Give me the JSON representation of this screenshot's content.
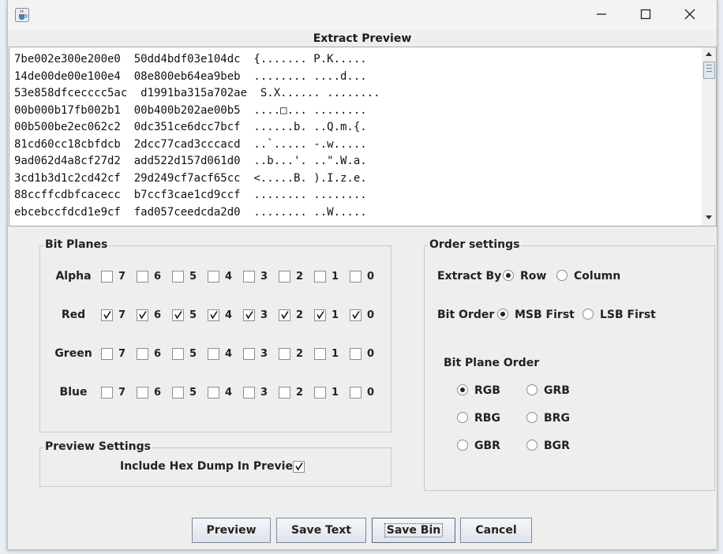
{
  "window": {
    "icon": "java-cup-icon",
    "controls": [
      "minimize-icon",
      "maximize-icon",
      "close-icon"
    ]
  },
  "preview": {
    "title": "Extract Preview",
    "lines": [
      "7be002e300e200e0  50dd4bdf03e104dc  {....... P.K.....",
      "14de00de00e100e4  08e800eb64ea9beb  ........ ....d...",
      "53e858dfcecccc5ac  d1991ba315a702ae  S.X...... ........",
      "00b000b17fb002b1  00b400b202ae00b5  ....□... ........",
      "00b500be2ec062c2  0dc351ce6dcc7bcf  ......b. ..Q.m.{.",
      "81cd60cc18cbfdcb  2dcc77cad3cccacd  ..`..... -.w.....",
      "9ad062d4a8cf27d2  add522d157d061d0  ..b...'. ..\".W.a.",
      "3cd1b3d1c2cd42cf  29d249cf7acf65cc  <.....B. ).I.z.e.",
      "88ccffcdbfcacecc  b7ccf3cae1cd9ccf  ........ ........",
      "ebcebccfdcd1e9cf  fad057ceedcda2d0  ........ ..W....."
    ]
  },
  "bit_planes": {
    "title": "Bit Planes",
    "bits": [
      "7",
      "6",
      "5",
      "4",
      "3",
      "2",
      "1",
      "0"
    ],
    "channels": [
      {
        "name": "Alpha",
        "checked": [
          false,
          false,
          false,
          false,
          false,
          false,
          false,
          false
        ]
      },
      {
        "name": "Red",
        "checked": [
          true,
          true,
          true,
          true,
          true,
          true,
          true,
          true
        ]
      },
      {
        "name": "Green",
        "checked": [
          false,
          false,
          false,
          false,
          false,
          false,
          false,
          false
        ]
      },
      {
        "name": "Blue",
        "checked": [
          false,
          false,
          false,
          false,
          false,
          false,
          false,
          false
        ]
      }
    ]
  },
  "preview_settings": {
    "title": "Preview Settings",
    "hex_dump_label": "Include Hex Dump In Preview",
    "hex_dump_checked": true
  },
  "order_settings": {
    "title": "Order settings",
    "extract_by_label": "Extract By",
    "extract_by_options": [
      "Row",
      "Column"
    ],
    "extract_by_selected": "Row",
    "bit_order_label": "Bit Order",
    "bit_order_options": [
      "MSB First",
      "LSB First"
    ],
    "bit_order_selected": "MSB First",
    "plane_order_label": "Bit Plane Order",
    "plane_order_options": [
      "RGB",
      "GRB",
      "RBG",
      "BRG",
      "GBR",
      "BGR"
    ],
    "plane_order_selected": "RGB"
  },
  "buttons": {
    "preview": "Preview",
    "save_text": "Save Text",
    "save_bin": "Save Bin",
    "cancel": "Cancel"
  }
}
